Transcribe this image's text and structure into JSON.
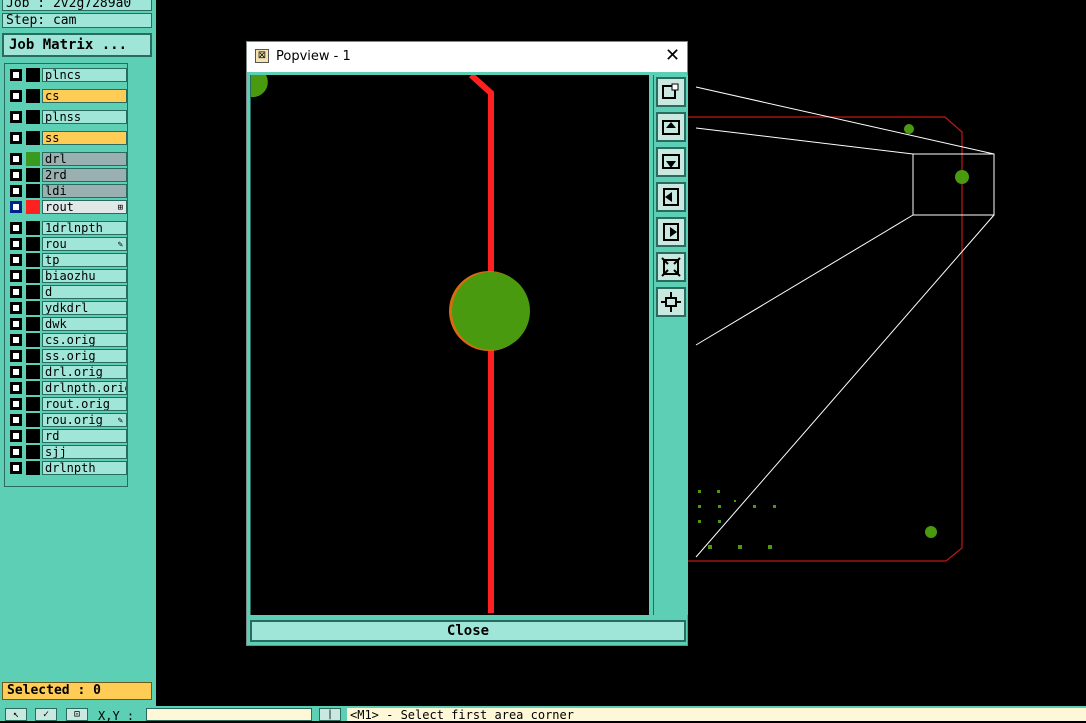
{
  "header": {
    "job": "Job : 2v2g7289a0",
    "step": "Step: cam",
    "job_matrix_label": "Job Matrix ..."
  },
  "layers": [
    {
      "name": "plncs",
      "color": "",
      "highlight": "",
      "mark": ""
    },
    {
      "name": "cs",
      "color": "",
      "highlight": "#ffcc55",
      "mark": ""
    },
    {
      "name": "plnss",
      "color": "",
      "highlight": "",
      "mark": ""
    },
    {
      "name": "ss",
      "color": "",
      "highlight": "#ffcc55",
      "mark": ""
    },
    {
      "name": "drl",
      "color": "#3a9a20",
      "highlight": "#9ab0b0",
      "mark": ""
    },
    {
      "name": "2rd",
      "color": "",
      "highlight": "#9ab0b0",
      "mark": ""
    },
    {
      "name": "ldi",
      "color": "",
      "highlight": "#9ab0b0",
      "mark": ""
    },
    {
      "name": "rout",
      "color": "#ff2020",
      "highlight": "#e0e8e8",
      "mark": "⊞",
      "active": true
    },
    {
      "name": "1drlnpth",
      "color": "",
      "highlight": "",
      "mark": ""
    },
    {
      "name": "rou",
      "color": "",
      "highlight": "",
      "mark": "✎"
    },
    {
      "name": "tp",
      "color": "",
      "highlight": "",
      "mark": ""
    },
    {
      "name": "biaozhu",
      "color": "",
      "highlight": "",
      "mark": ""
    },
    {
      "name": "d",
      "color": "",
      "highlight": "",
      "mark": ""
    },
    {
      "name": "ydkdrl",
      "color": "",
      "highlight": "",
      "mark": ""
    },
    {
      "name": "dwk",
      "color": "",
      "highlight": "",
      "mark": ""
    },
    {
      "name": "cs.orig",
      "color": "",
      "highlight": "",
      "mark": ""
    },
    {
      "name": "ss.orig",
      "color": "",
      "highlight": "",
      "mark": ""
    },
    {
      "name": "drl.orig",
      "color": "",
      "highlight": "",
      "mark": ""
    },
    {
      "name": "drlnpth.orig",
      "color": "",
      "highlight": "",
      "mark": ""
    },
    {
      "name": "rout.orig",
      "color": "",
      "highlight": "",
      "mark": ""
    },
    {
      "name": "rou.orig",
      "color": "",
      "highlight": "",
      "mark": "✎"
    },
    {
      "name": "rd",
      "color": "",
      "highlight": "",
      "mark": ""
    },
    {
      "name": "sjj",
      "color": "",
      "highlight": "",
      "mark": ""
    },
    {
      "name": "drlnpth",
      "color": "",
      "highlight": "",
      "mark": ""
    }
  ],
  "selected": "Selected : 0",
  "popup": {
    "title": "Popview - 1",
    "close_label": "Close",
    "tools": [
      "zoom-home-icon",
      "pan-up-icon",
      "pan-down-icon",
      "pan-left-icon",
      "pan-right-icon",
      "zoom-out-icon",
      "zoom-in-icon"
    ]
  },
  "bottom": {
    "xy_label": "X,Y :",
    "xy_value": "",
    "status": "<M1> - Select first area corner"
  },
  "colors": {
    "panel": "#5ccfb5",
    "field": "#a0e6d8",
    "highlight": "#ffcc55",
    "pad": "#4a9a10",
    "route": "#ff2020",
    "outline": "#c01818"
  }
}
